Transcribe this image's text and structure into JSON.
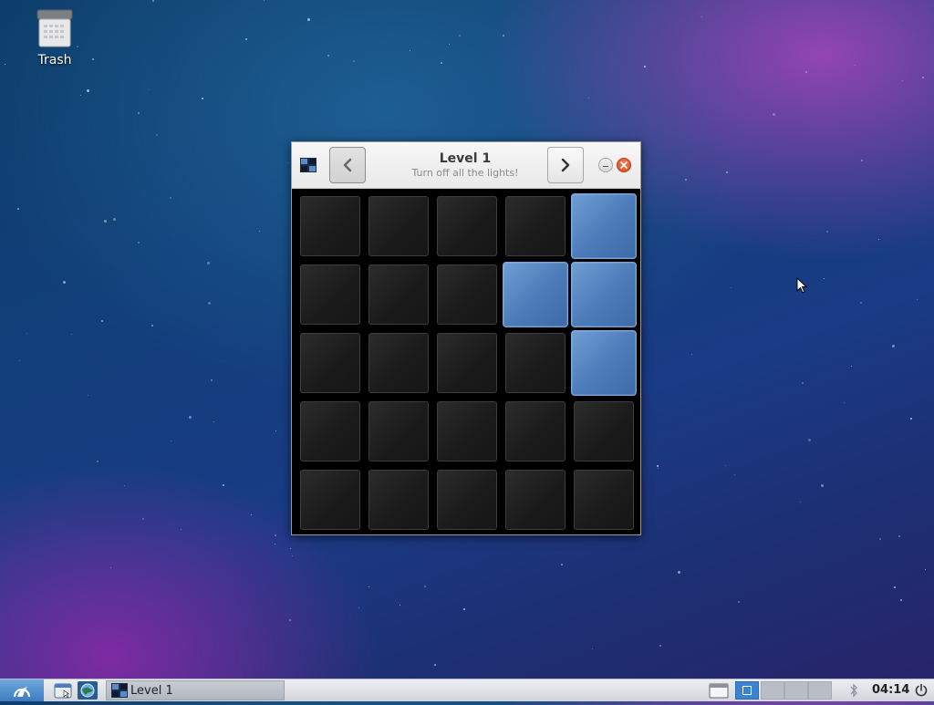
{
  "desktop": {
    "icons": [
      {
        "label": "Trash",
        "icon": "trash-icon"
      }
    ]
  },
  "window": {
    "title": "Level 1",
    "subtitle": "Turn off all the lights!",
    "prev_icon": "chevron-left-icon",
    "next_icon": "chevron-right-icon",
    "minimize_icon": "minimize-icon",
    "close_icon": "close-icon",
    "app_icon": "lights-off-icon"
  },
  "board": {
    "rows": 5,
    "cols": 5,
    "cells": [
      [
        0,
        0,
        0,
        0,
        1
      ],
      [
        0,
        0,
        0,
        1,
        1
      ],
      [
        0,
        0,
        0,
        0,
        1
      ],
      [
        0,
        0,
        0,
        0,
        0
      ],
      [
        0,
        0,
        0,
        0,
        0
      ]
    ],
    "on_color": "#5b8bc8",
    "off_color": "#1e1e1e"
  },
  "taskbar": {
    "start_icon": "start-menu-icon",
    "launchers": [
      "file-manager-icon",
      "browser-icon"
    ],
    "task": {
      "label": "Level 1",
      "icon": "lights-off-icon"
    },
    "workspaces": 4,
    "active_workspace": 1,
    "tray_icons": [
      "bluetooth-icon",
      "power-icon"
    ],
    "clock": "04:14"
  }
}
